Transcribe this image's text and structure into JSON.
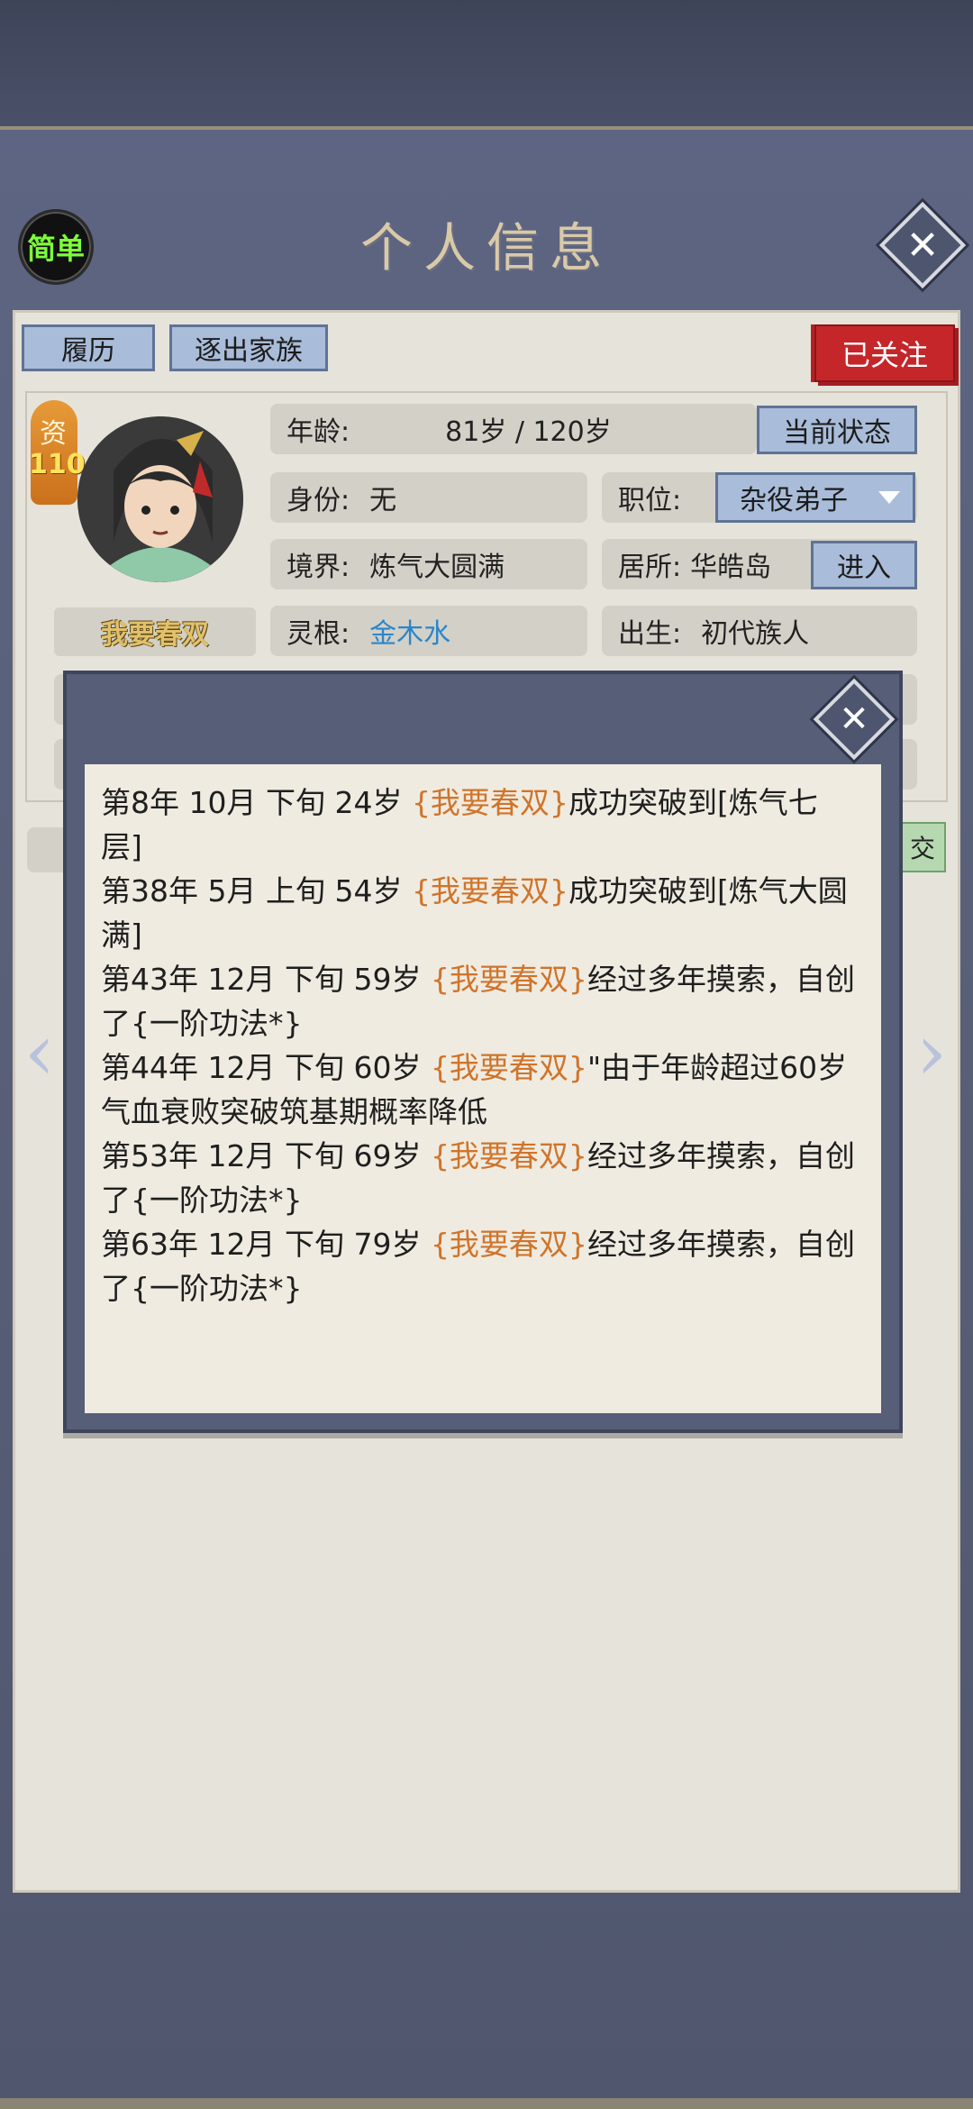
{
  "header": {
    "mode_label": "简单",
    "title": "个人信息"
  },
  "tabs": {
    "history_label": "履历",
    "expel_label": "逐出家族",
    "follow_label": "已关注"
  },
  "profile": {
    "aptitude_label": "资",
    "aptitude_value": "110",
    "name": "我要春双",
    "age_label": "年龄:",
    "age_value": "81岁 / 120岁",
    "status_button": "当前状态",
    "identity_label": "身份:",
    "identity_value": "无",
    "position_label": "职位:",
    "position_value": "杂役弟子",
    "realm_label": "境界:",
    "realm_value": "炼气大圆满",
    "residence_label": "居所:",
    "residence_value": "华皓岛",
    "enter_button": "进入",
    "root_label": "灵根:",
    "root_value": "金木水",
    "birth_label": "出生:",
    "birth_value": "初代族人",
    "colors": {
      "root_value": "#2b86c9",
      "highlight": "#d0742a",
      "follow": "#c4262a"
    }
  },
  "partial_button": "交",
  "history_log": [
    {
      "prefix": "第8年 10月 下旬  24岁 ",
      "name": "{我要春双}",
      "suffix": "成功突破到[炼气七层]"
    },
    {
      "prefix": "第38年 5月 上旬 54岁 ",
      "name": "{我要春双}",
      "suffix": "成功突破到[炼气大圆满]"
    },
    {
      "prefix": "第43年 12月 下旬  59岁 ",
      "name": "{我要春双}",
      "suffix": "经过多年摸索，自创了{一阶功法*}"
    },
    {
      "prefix": "第44年 12月 下旬 60岁 ",
      "name": "{我要春双}",
      "suffix": "\"由于年龄超过60岁气血衰败突破筑基期概率降低"
    },
    {
      "prefix": "第53年 12月 下旬  69岁 ",
      "name": "{我要春双}",
      "suffix": "经过多年摸索，自创了{一阶功法*}"
    },
    {
      "prefix": "第63年 12月 下旬  79岁 ",
      "name": "{我要春双}",
      "suffix": "经过多年摸索，自创了{一阶功法*}"
    }
  ]
}
